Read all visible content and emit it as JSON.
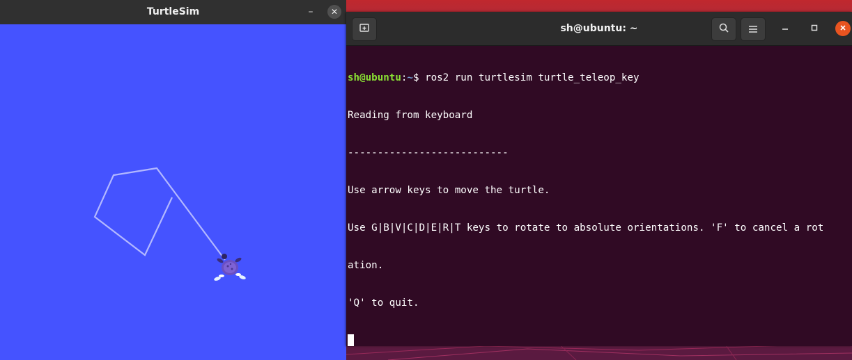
{
  "turtlesim": {
    "title": "TurtleSim",
    "minimize": "–",
    "close": "✕",
    "background_color": "#4553ff",
    "pen_color": "#b3b8ff"
  },
  "terminal": {
    "title": "sh@ubuntu: ~",
    "icons": {
      "new_tab": "new-tab-icon",
      "search": "search-icon",
      "menu": "hamburger-menu-icon",
      "minimize": "minimize-icon",
      "maximize": "maximize-icon",
      "close": "close-icon"
    },
    "prompt_user": "sh@ubuntu",
    "prompt_sep": ":",
    "prompt_path": "~",
    "prompt_symbol": "$ ",
    "command": "ros2 run turtlesim turtle_teleop_key",
    "lines": [
      "Reading from keyboard",
      "---------------------------",
      "Use arrow keys to move the turtle.",
      "Use G|B|V|C|D|E|R|T keys to rotate to absolute orientations. 'F' to cancel a rot",
      "ation.",
      "'Q' to quit."
    ],
    "accent_color": "#e95420"
  }
}
